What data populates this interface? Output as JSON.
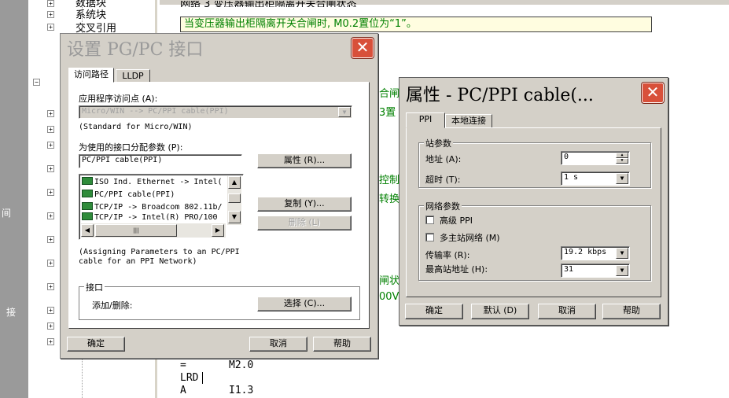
{
  "tree": {
    "items": [
      "数据块",
      "系统块",
      "交叉引用"
    ]
  },
  "left_strip": {
    "label_1": "间",
    "label_2": "接"
  },
  "editor": {
    "network_header": "网络 3    变压器输出柜隔离开关合闸状态",
    "network_comment": "当变压器输出柜隔离开关合闸时, M0.2置位为“1”。",
    "frag_1": "合闸",
    "frag_2": "3置",
    "frag_3": "控制",
    "frag_4": "转换",
    "frag_5": "闸状",
    "frag_6": "00V",
    "code": [
      {
        "op": "=",
        "operand": "M2.0"
      },
      {
        "op": "LRD",
        "operand": ""
      },
      {
        "op": "A",
        "operand": "I1.3"
      }
    ]
  },
  "pgpc_dialog": {
    "title": "设置 PG/PC 接口",
    "tabs": [
      "访问路径",
      "LLDP"
    ],
    "access_point_label": "应用程序访问点 (A):",
    "access_point_value": "Micro/WIN        --> PC/PPI cable(PPI)",
    "access_point_desc": "(Standard for Micro/WIN)",
    "param_label": "为使用的接口分配参数 (P):",
    "param_value": "PC/PPI cable(PPI)",
    "interface_list": [
      "ISO Ind. Ethernet -> Intel(",
      "PC/PPI cable(PPI)",
      "TCP/IP -> Broadcom 802.11b/",
      "TCP/IP -> Intel(R) PRO/100"
    ],
    "hscroll_thumb": "|||",
    "properties_button": "属性 (R)...",
    "copy_button": "复制 (Y)...",
    "delete_button": "删除 (L)",
    "assign_desc_1": "(Assigning Parameters to an PC/PPI",
    "assign_desc_2": "cable for an PPI Network)",
    "interface_group": "接口",
    "add_remove_label": "添加/删除:",
    "select_button": "选择 (C)...",
    "ok_button": "确定",
    "cancel_button": "取消",
    "help_button": "帮助",
    "close_glyph": "✕"
  },
  "props_dialog": {
    "title": "属性 - PC/PPI cable(...",
    "tabs": [
      "PPI",
      "本地连接"
    ],
    "station_group": "站参数",
    "address_label": "地址 (A):",
    "address_value": "0",
    "timeout_label": "超时 (T):",
    "timeout_value": "1 s",
    "network_group": "网络参数",
    "advanced_ppi_label": "高级 PPI",
    "multi_master_label": "多主站网络 (M)",
    "baud_label": "传输率 (R):",
    "baud_value": "19.2 kbps",
    "highest_addr_label": "最高站地址 (H):",
    "highest_addr_value": "31",
    "ok_button": "确定",
    "default_button": "默认 (D)",
    "cancel_button": "取消",
    "help_button": "帮助",
    "close_glyph": "✕"
  }
}
